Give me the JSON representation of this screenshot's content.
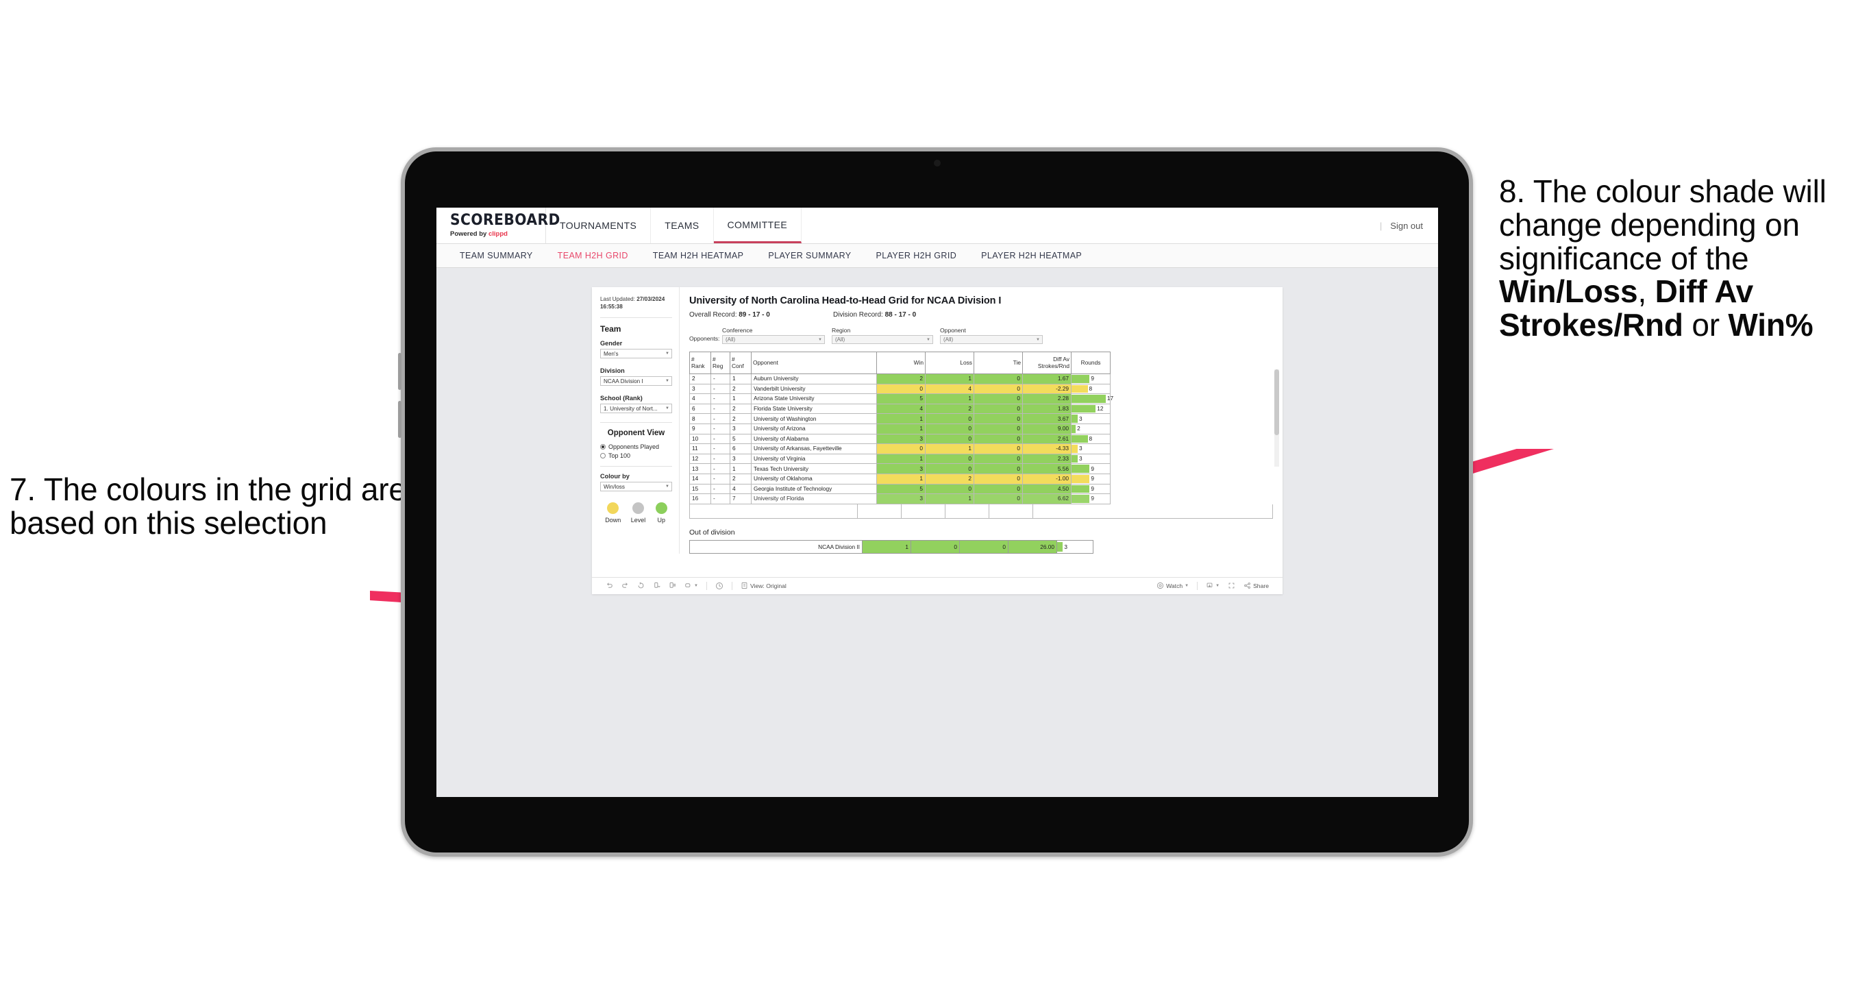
{
  "annotations": {
    "left": "7. The colours in the grid are based on this selection",
    "right_parts": [
      {
        "t": "8. The colour shade will change depending on significance of the ",
        "b": false
      },
      {
        "t": "Win/Loss",
        "b": true
      },
      {
        "t": ", ",
        "b": false
      },
      {
        "t": "Diff Av Strokes/Rnd",
        "b": true
      },
      {
        "t": " or ",
        "b": false
      },
      {
        "t": "Win%",
        "b": true
      }
    ],
    "arrow_color": "#ef2f5f"
  },
  "app": {
    "brand": {
      "logo": "SCOREBOARD",
      "powered_prefix": "Powered by ",
      "powered_brand": "clippd"
    },
    "topnav": [
      {
        "label": "TOURNAMENTS",
        "active": false
      },
      {
        "label": "TEAMS",
        "active": false
      },
      {
        "label": "COMMITTEE",
        "active": true
      }
    ],
    "header_right": {
      "separator": "|",
      "signout": "Sign out"
    },
    "subnav": [
      {
        "label": "TEAM SUMMARY",
        "active": false
      },
      {
        "label": "TEAM H2H GRID",
        "active": true
      },
      {
        "label": "TEAM H2H HEATMAP",
        "active": false
      },
      {
        "label": "PLAYER SUMMARY",
        "active": false
      },
      {
        "label": "PLAYER H2H GRID",
        "active": false
      },
      {
        "label": "PLAYER H2H HEATMAP",
        "active": false
      }
    ]
  },
  "filters": {
    "last_updated_label": "Last Updated: ",
    "last_updated_value": "27/03/2024 16:55:38",
    "team_heading": "Team",
    "gender_label": "Gender",
    "gender_value": "Men's",
    "division_label": "Division",
    "division_value": "NCAA Division I",
    "school_label": "School (Rank)",
    "school_value": "1. University of Nort...",
    "opponent_view_heading": "Opponent View",
    "opponent_view_options": [
      {
        "label": "Opponents Played",
        "selected": true
      },
      {
        "label": "Top 100",
        "selected": false
      }
    ],
    "colour_by_label": "Colour by",
    "colour_by_value": "Win/loss",
    "legend": [
      {
        "label": "Down",
        "color": "#f2d75b"
      },
      {
        "label": "Level",
        "color": "#c4c4c4"
      },
      {
        "label": "Up",
        "color": "#8ccf5c"
      }
    ]
  },
  "report": {
    "title": "University of North Carolina Head-to-Head Grid for NCAA Division I",
    "overall_record_label": "Overall Record: ",
    "overall_record_value": "89 - 17 - 0",
    "division_record_label": "Division Record: ",
    "division_record_value": "88 - 17 - 0",
    "opponents_label": "Opponents:",
    "opponent_filters": [
      {
        "caption": "Conference",
        "value": "(All)"
      },
      {
        "caption": "Region",
        "value": "(All)"
      },
      {
        "caption": "Opponent",
        "value": "(All)"
      }
    ],
    "columns": [
      {
        "line1": "#",
        "line2": "Rank"
      },
      {
        "line1": "#",
        "line2": "Reg"
      },
      {
        "line1": "#",
        "line2": "Conf"
      },
      {
        "line1": "Opponent",
        "line2": ""
      },
      {
        "line1": "Win",
        "line2": ""
      },
      {
        "line1": "Loss",
        "line2": ""
      },
      {
        "line1": "Tie",
        "line2": ""
      },
      {
        "line1": "Diff Av",
        "line2": "Strokes/Rnd"
      },
      {
        "line1": "Rounds",
        "line2": ""
      }
    ],
    "rows": [
      {
        "rank": "2",
        "reg": "-",
        "conf": "1",
        "opponent": "Auburn University",
        "win": "2",
        "loss": "1",
        "tie": "0",
        "diff": "1.67",
        "rounds": "9",
        "bar_pct": 47,
        "state": "up"
      },
      {
        "rank": "3",
        "reg": "-",
        "conf": "2",
        "opponent": "Vanderbilt University",
        "win": "0",
        "loss": "4",
        "tie": "0",
        "diff": "-2.29",
        "rounds": "8",
        "bar_pct": 42,
        "state": "down"
      },
      {
        "rank": "4",
        "reg": "-",
        "conf": "1",
        "opponent": "Arizona State University",
        "win": "5",
        "loss": "1",
        "tie": "0",
        "diff": "2.28",
        "rounds": "17",
        "bar_pct": 89,
        "state": "up"
      },
      {
        "rank": "6",
        "reg": "-",
        "conf": "2",
        "opponent": "Florida State University",
        "win": "4",
        "loss": "2",
        "tie": "0",
        "diff": "1.83",
        "rounds": "12",
        "bar_pct": 63,
        "state": "up"
      },
      {
        "rank": "8",
        "reg": "-",
        "conf": "2",
        "opponent": "University of Washington",
        "win": "1",
        "loss": "0",
        "tie": "0",
        "diff": "3.67",
        "rounds": "3",
        "bar_pct": 16,
        "state": "up"
      },
      {
        "rank": "9",
        "reg": "-",
        "conf": "3",
        "opponent": "University of Arizona",
        "win": "1",
        "loss": "0",
        "tie": "0",
        "diff": "9.00",
        "rounds": "2",
        "bar_pct": 11,
        "state": "up"
      },
      {
        "rank": "10",
        "reg": "-",
        "conf": "5",
        "opponent": "University of Alabama",
        "win": "3",
        "loss": "0",
        "tie": "0",
        "diff": "2.61",
        "rounds": "8",
        "bar_pct": 42,
        "state": "up"
      },
      {
        "rank": "11",
        "reg": "-",
        "conf": "6",
        "opponent": "University of Arkansas, Fayetteville",
        "win": "0",
        "loss": "1",
        "tie": "0",
        "diff": "-4.33",
        "rounds": "3",
        "bar_pct": 16,
        "state": "down"
      },
      {
        "rank": "12",
        "reg": "-",
        "conf": "3",
        "opponent": "University of Virginia",
        "win": "1",
        "loss": "0",
        "tie": "0",
        "diff": "2.33",
        "rounds": "3",
        "bar_pct": 16,
        "state": "up"
      },
      {
        "rank": "13",
        "reg": "-",
        "conf": "1",
        "opponent": "Texas Tech University",
        "win": "3",
        "loss": "0",
        "tie": "0",
        "diff": "5.56",
        "rounds": "9",
        "bar_pct": 47,
        "state": "up"
      },
      {
        "rank": "14",
        "reg": "-",
        "conf": "2",
        "opponent": "University of Oklahoma",
        "win": "1",
        "loss": "2",
        "tie": "0",
        "diff": "-1.00",
        "rounds": "9",
        "bar_pct": 47,
        "state": "down"
      },
      {
        "rank": "15",
        "reg": "-",
        "conf": "4",
        "opponent": "Georgia Institute of Technology",
        "win": "5",
        "loss": "0",
        "tie": "0",
        "diff": "4.50",
        "rounds": "9",
        "bar_pct": 47,
        "state": "up"
      },
      {
        "rank": "16",
        "reg": "-",
        "conf": "7",
        "opponent": "University of Florida",
        "win": "3",
        "loss": "1",
        "tie": "0",
        "diff": "6.62",
        "rounds": "9",
        "bar_pct": 47,
        "state": "up"
      }
    ],
    "out_of_division_title": "Out of division",
    "out_of_division_row": {
      "label": "NCAA Division II",
      "win": "1",
      "loss": "0",
      "tie": "0",
      "diff": "26.00",
      "rounds": "3",
      "bar_pct": 16,
      "state": "up"
    }
  },
  "toolbar": {
    "view_label": "View: Original",
    "watch_label": "Watch",
    "share_label": "Share"
  }
}
